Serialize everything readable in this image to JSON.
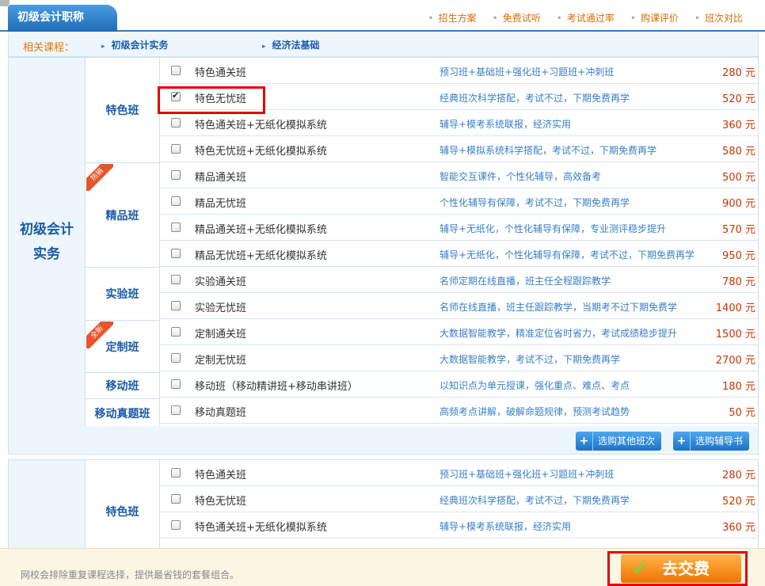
{
  "header": {
    "title": "初级会计职称",
    "nav": [
      "招生方案",
      "免费试听",
      "考试通过率",
      "购课评价",
      "班次对比"
    ]
  },
  "related": {
    "label": "相关课程：",
    "courses": [
      "初级会计实务",
      "经济法基础"
    ]
  },
  "block1": {
    "category": "初级会计实务",
    "groups": [
      {
        "name": "特色班"
      },
      {
        "name": "精品班",
        "ribbon": "热销"
      },
      {
        "name": "实验班"
      },
      {
        "name": "定制班",
        "ribbon": "全新"
      },
      {
        "name": "移动班"
      },
      {
        "name": "移动真题班"
      }
    ],
    "rows": [
      {
        "name": "特色通关班",
        "desc": "预习班+基础班+强化班+习题班+冲刺班",
        "price": "280 元",
        "checked": false
      },
      {
        "name": "特色无忧班",
        "desc": "经典班次科学搭配，考试不过，下期免费再学",
        "price": "520 元",
        "checked": true
      },
      {
        "name": "特色通关班+无纸化模拟系统",
        "desc": "辅导+模考系统联报，经济实用",
        "price": "360 元",
        "checked": false
      },
      {
        "name": "特色无忧班+无纸化模拟系统",
        "desc": "辅导+模拟系统科学搭配，考试不过，下期免费再学",
        "price": "580 元",
        "checked": false
      },
      {
        "name": "精品通关班",
        "desc": "智能交互课件，个性化辅导，高效备考",
        "price": "500 元",
        "checked": false
      },
      {
        "name": "精品无忧班",
        "desc": "个性化辅导有保障，考试不过，下期免费再学",
        "price": "900 元",
        "checked": false
      },
      {
        "name": "精品通关班+无纸化模拟系统",
        "desc": "辅导+无纸化，个性化辅导有保障，专业测评稳步提升",
        "price": "570 元",
        "checked": false
      },
      {
        "name": "精品无忧班+无纸化模拟系统",
        "desc": "辅导+无纸化，个性化辅导有保障，考试不过，下期免费再学",
        "price": "950 元",
        "checked": false
      },
      {
        "name": "实验通关班",
        "desc": "名师定期在线直播，班主任全程跟踪教学",
        "price": "780 元",
        "checked": false
      },
      {
        "name": "实验无忧班",
        "desc": "名师在线直播，班主任跟踪教学，当期考不过下期免费学",
        "price": "1400 元",
        "checked": false
      },
      {
        "name": "定制通关班",
        "desc": "大数据智能教学，精准定位省时省力，考试成绩稳步提升",
        "price": "1500 元",
        "checked": false
      },
      {
        "name": "定制无忧班",
        "desc": "大数据智能教学，考试不过，下期免费再学",
        "price": "2700 元",
        "checked": false
      },
      {
        "name": "移动班（移动精讲班+移动串讲班）",
        "desc": "以知识点为单元授课，强化重点、难点、考点",
        "price": "180 元",
        "checked": false
      },
      {
        "name": "移动真题班",
        "desc": "高频考点讲解，破解命题规律，预测考试趋势",
        "price": "50 元",
        "checked": false
      }
    ]
  },
  "buttons": {
    "plus": "+",
    "other_classes": "选购其他班次",
    "books": "选购辅导书"
  },
  "block2": {
    "group": "特色班",
    "rows": [
      {
        "name": "特色通关班",
        "desc": "预习班+基础班+强化班+习题班+冲刺班",
        "price": "280 元",
        "checked": false
      },
      {
        "name": "特色无忧班",
        "desc": "经典班次科学搭配，考试不过，下期免费再学",
        "price": "520 元",
        "checked": false
      },
      {
        "name": "特色通关班+无纸化模拟系统",
        "desc": "辅导+模考系统联报，经济实用",
        "price": "360 元",
        "checked": false
      }
    ]
  },
  "footer": {
    "note": "网校会排除重复课程选择，提供最省钱的套餐组合。",
    "pay_label": "去交费"
  },
  "colors": {
    "brand_blue": "#1d6cb5",
    "price_red": "#cc3300",
    "highlight_red": "#e60000",
    "pay_orange": "#ef7300"
  }
}
